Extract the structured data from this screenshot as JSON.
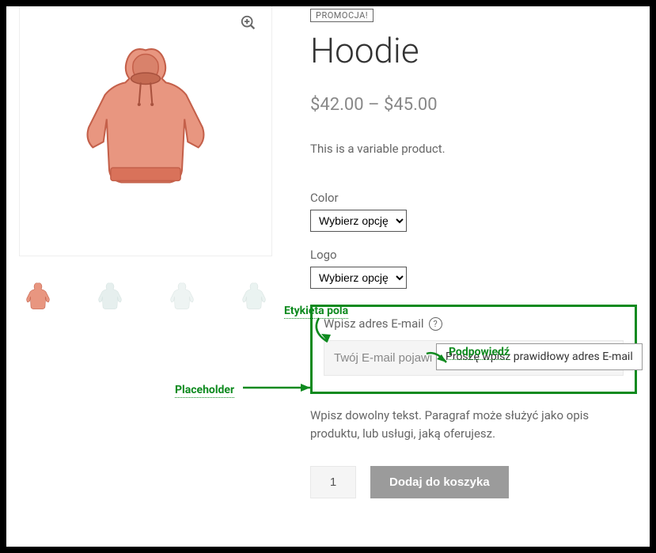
{
  "product": {
    "promo_badge": "PROMOCJA!",
    "title": "Hoodie",
    "price_range": "$42.00 – $45.00",
    "short_description": "This is a variable product."
  },
  "variations": {
    "color_label": "Color",
    "color_placeholder": "Wybierz opcję",
    "logo_label": "Logo",
    "logo_placeholder": "Wybierz opcję"
  },
  "email_field": {
    "label": "Wpisz adres E-mail",
    "placeholder": "Twój E-mail pojawi się na produkcie",
    "tooltip": "Proszę wpisz prawidłowy adres E-mail"
  },
  "paragraph": "Wpisz dowolny tekst. Paragraf może służyć jako opis produktu, lub usługi, jaką oferujesz.",
  "cart": {
    "quantity": "1",
    "add_button": "Dodaj do koszyka"
  },
  "annotations": {
    "field_label": "Etykieta pola",
    "tooltip": "Podpowiedź",
    "placeholder": "Placeholder"
  },
  "colors": {
    "annotation_green": "#0e8a1f",
    "text_gray": "#666",
    "light_gray": "#888",
    "button_gray": "#9b9b9b"
  }
}
